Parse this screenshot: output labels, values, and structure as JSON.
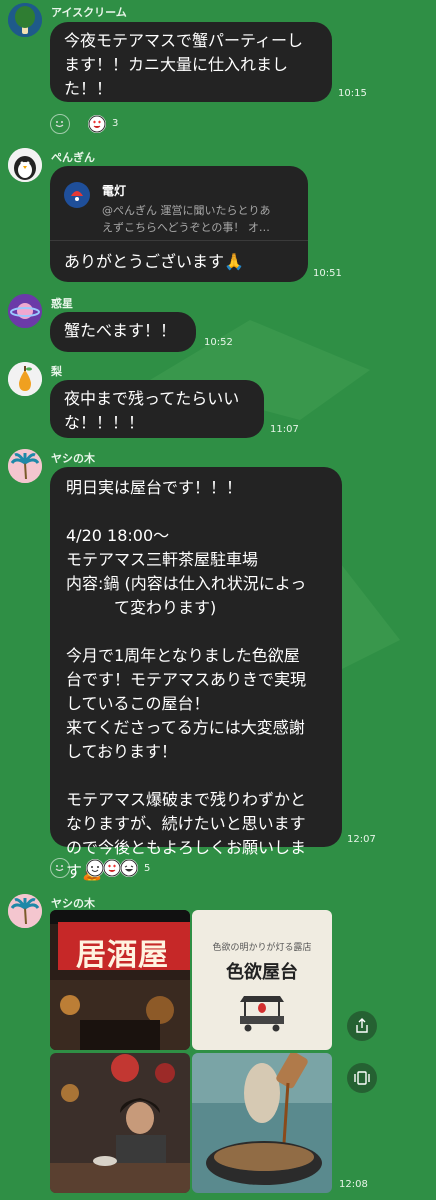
{
  "colors": {
    "background": "#2f8f45",
    "bubble": "#232323",
    "text": "#ffffff",
    "meta": "#e8f5e9"
  },
  "messages": [
    {
      "sender": "アイスクリーム",
      "text": [
        "今夜モテアマスで蟹パーティーし",
        "ます！！カニ大量に仕入れまし",
        "た！！"
      ],
      "time": "10:15",
      "reaction_count": "3"
    },
    {
      "sender": "ぺんぎん",
      "reply": {
        "title": "電灯",
        "preview": [
          "@ぺんぎん 運営に聞いたらとりあ",
          "えずこちらへどうぞとの事！ オ…"
        ]
      },
      "text": [
        "ありがとうございます🙏"
      ],
      "time": "10:51"
    },
    {
      "sender": "惑星",
      "text": [
        "蟹たべます！！"
      ],
      "time": "10:52"
    },
    {
      "sender": "梨",
      "text": [
        "夜中まで残ってたらいい",
        "な！！！！"
      ],
      "time": "11:07"
    },
    {
      "sender": "ヤシの木",
      "text": [
        "明日実は屋台です！！！",
        "",
        "4/20 18:00～",
        "モテアマス三軒茶屋駐車場",
        "内容:鍋 (内容は仕入れ状況によっ",
        "　　　て変わります)",
        "",
        "今月で1周年となりました色欲屋",
        "台です！モテアマスありきで実現",
        "しているこの屋台！",
        "来てくださってる方には大変感謝",
        "しております！",
        "",
        "モテアマス爆破まで残りわずかと",
        "なりますが、続けたいと思います",
        "ので今後ともよろしくお願いしま",
        "す🙇"
      ],
      "time": "12:07",
      "reaction_count": "5"
    },
    {
      "sender": "ヤシの木",
      "time": "12:08",
      "photos": {
        "sign": "居酒屋",
        "card_small": "色欲の明かりが灯る露店",
        "card_title": "色欲屋台"
      }
    }
  ],
  "icons": {
    "reaction": "smiley-icon",
    "share": "share-icon",
    "album": "album-icon"
  }
}
